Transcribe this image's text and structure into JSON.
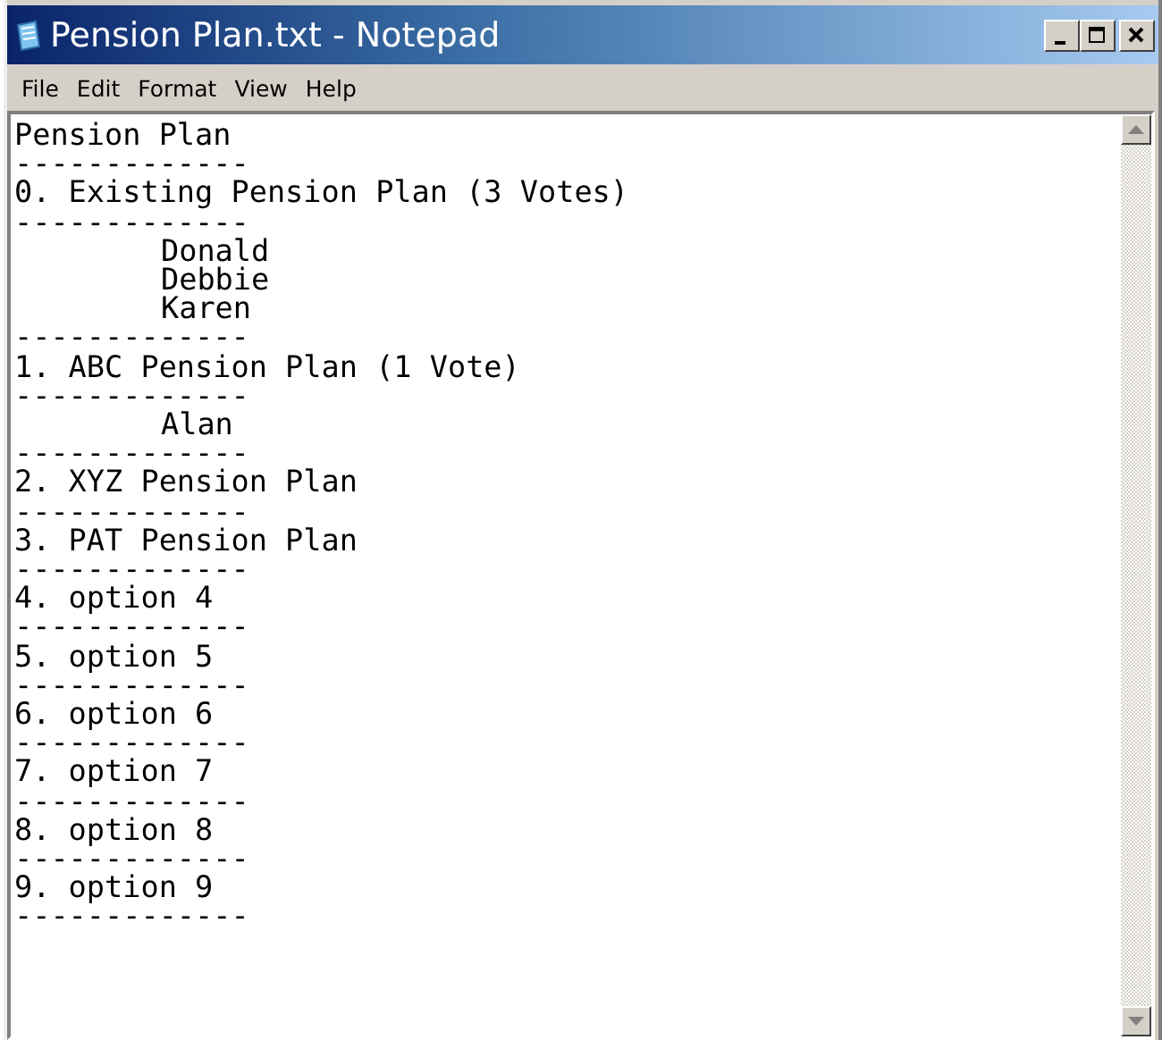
{
  "window": {
    "title": "Pension Plan.txt - Notepad"
  },
  "menu": [
    "File",
    "Edit",
    "Format",
    "View",
    "Help"
  ],
  "document": {
    "lines": [
      {
        "kind": "plain",
        "text": "Pension Plan"
      },
      {
        "kind": "plain",
        "text": "-------------"
      },
      {
        "kind": "plain",
        "text": "0. Existing Pension Plan (3 Votes)"
      },
      {
        "kind": "plain",
        "text": "-------------"
      },
      {
        "kind": "indented",
        "text": "Donald"
      },
      {
        "kind": "indented",
        "text": "Debbie"
      },
      {
        "kind": "indented",
        "text": "Karen"
      },
      {
        "kind": "plain",
        "text": "-------------"
      },
      {
        "kind": "plain",
        "text": "1. ABC Pension Plan (1 Vote)"
      },
      {
        "kind": "plain",
        "text": "-------------"
      },
      {
        "kind": "indented",
        "text": "Alan"
      },
      {
        "kind": "plain",
        "text": "-------------"
      },
      {
        "kind": "plain",
        "text": "2. XYZ Pension Plan"
      },
      {
        "kind": "plain",
        "text": "-------------"
      },
      {
        "kind": "plain",
        "text": "3. PAT Pension Plan"
      },
      {
        "kind": "plain",
        "text": "-------------"
      },
      {
        "kind": "plain",
        "text": "4. option 4"
      },
      {
        "kind": "plain",
        "text": "-------------"
      },
      {
        "kind": "plain",
        "text": "5. option 5"
      },
      {
        "kind": "plain",
        "text": "-------------"
      },
      {
        "kind": "plain",
        "text": "6. option 6"
      },
      {
        "kind": "plain",
        "text": "-------------"
      },
      {
        "kind": "plain",
        "text": "7. option 7"
      },
      {
        "kind": "plain",
        "text": "-------------"
      },
      {
        "kind": "plain",
        "text": "8. option 8"
      },
      {
        "kind": "plain",
        "text": "-------------"
      },
      {
        "kind": "plain",
        "text": "9. option 9"
      },
      {
        "kind": "plain",
        "text": "-------------"
      }
    ]
  }
}
